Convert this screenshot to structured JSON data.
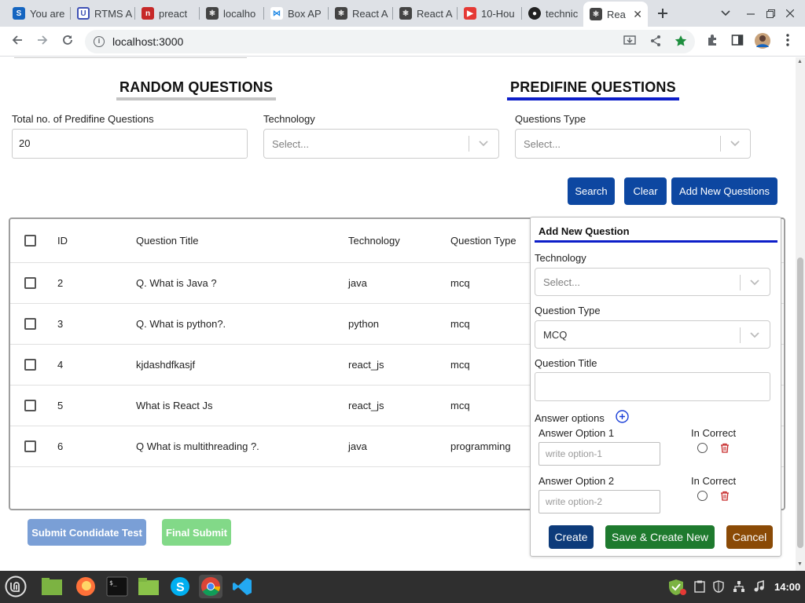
{
  "browser": {
    "tabs": [
      {
        "label": "You are",
        "favicon": "s-icon",
        "color": "#1565c0"
      },
      {
        "label": "RTMS A",
        "favicon": "u-icon",
        "color": "#3f51b5"
      },
      {
        "label": "preact",
        "favicon": "n-icon",
        "color": "#c62828"
      },
      {
        "label": "localho",
        "favicon": "react-icon",
        "color": "#444"
      },
      {
        "label": "Box AP",
        "favicon": "box-icon",
        "color": "#1e88e5"
      },
      {
        "label": "React A",
        "favicon": "react-icon",
        "color": "#444"
      },
      {
        "label": "React A",
        "favicon": "react-icon",
        "color": "#444"
      },
      {
        "label": "10-Hou",
        "favicon": "youtube-icon",
        "color": "#e53935"
      },
      {
        "label": "technic",
        "favicon": "github-icon",
        "color": "#222"
      },
      {
        "label": "Rea",
        "favicon": "react-icon",
        "color": "#444",
        "active": true
      }
    ],
    "url": "localhost:3000"
  },
  "page": {
    "tabs": {
      "random": "RANDOM QUESTIONS",
      "predefine": "PREDIFINE QUESTIONS"
    },
    "filters": {
      "total_label": "Total no. of Predifine Questions",
      "total_value": "20",
      "technology_label": "Technology",
      "technology_placeholder": "Select...",
      "type_label": "Questions Type",
      "type_placeholder": "Select..."
    },
    "actions": {
      "search": "Search",
      "clear": "Clear",
      "add_new": "Add New Questions"
    },
    "table": {
      "headers": {
        "id": "ID",
        "title": "Question Title",
        "technology": "Technology",
        "type": "Question Type"
      },
      "rows": [
        {
          "id": "2",
          "title": "Q. What is Java ?",
          "technology": "java",
          "type": "mcq"
        },
        {
          "id": "3",
          "title": "Q. What is python?.",
          "technology": "python",
          "type": "mcq"
        },
        {
          "id": "4",
          "title": "kjdashdfkasjf",
          "technology": "react_js",
          "type": "mcq"
        },
        {
          "id": "5",
          "title": "What is React Js",
          "technology": "react_js",
          "type": "mcq"
        },
        {
          "id": "6",
          "title": "Q What is multithreading ?.",
          "technology": "java",
          "type": "programming"
        }
      ]
    },
    "bottom": {
      "submit_test": "Submit Condidate Test",
      "final_submit": "Final Submit"
    }
  },
  "panel": {
    "title": "Add New Question",
    "technology_label": "Technology",
    "technology_placeholder": "Select...",
    "type_label": "Question Type",
    "type_value": "MCQ",
    "question_title_label": "Question Title",
    "question_title_value": "",
    "answer_options_label": "Answer options",
    "options": [
      {
        "label": "Answer Option 1",
        "placeholder": "write option-1",
        "correct_label": "In Correct"
      },
      {
        "label": "Answer Option 2",
        "placeholder": "write option-2",
        "correct_label": "In Correct"
      }
    ],
    "create": "Create",
    "save_create_new": "Save & Create New",
    "cancel": "Cancel"
  },
  "taskbar": {
    "clock": "14:00"
  },
  "colors": {
    "primary": "#0d47a1",
    "active_tab_underline": "#0d1ec9",
    "inactive_tab_underline": "#c4c4c4",
    "create_button": "#0d3b7a",
    "save_button": "#1e7a2e",
    "cancel_button": "#8a4a06",
    "delete_icon": "#c62828"
  }
}
